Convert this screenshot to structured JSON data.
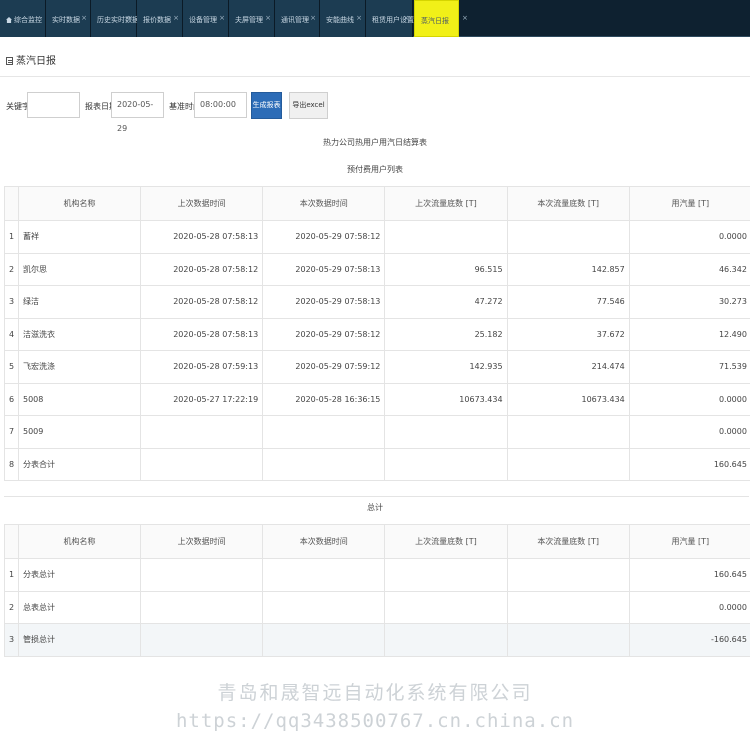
{
  "tabs": [
    {
      "label": "综合监控",
      "active": false,
      "closable": false
    },
    {
      "label": "实时数据",
      "active": false,
      "closable": true
    },
    {
      "label": "历史实时数据",
      "active": false,
      "closable": true
    },
    {
      "label": "报价数据",
      "active": false,
      "closable": true
    },
    {
      "label": "设备管理",
      "active": false,
      "closable": true
    },
    {
      "label": "夫屏管理",
      "active": false,
      "closable": true
    },
    {
      "label": "通讯管理",
      "active": false,
      "closable": true
    },
    {
      "label": "安能曲线",
      "active": false,
      "closable": true
    },
    {
      "label": "租赁用户设置",
      "active": false,
      "closable": true
    },
    {
      "label": "蒸汽日报",
      "active": true,
      "closable": true
    }
  ],
  "tab_close_glyph": "×",
  "page_title": "蒸汽日报",
  "search": {
    "keyword_label": "关键字:",
    "keyword_value": "",
    "date_label": "报表日期:",
    "date_value": "2020-05-29",
    "time_label": "基准时间:",
    "time_value": "08:00:00",
    "generate_button": "生成报表",
    "export_button": "导出excel"
  },
  "report_title": "热力公司热用户用汽日结算表",
  "section1_title": "预付费用户列表",
  "columns": [
    "机构名称",
    "上次数据时间",
    "本次数据时间",
    "上次流量底数 [T]",
    "本次流量底数 [T]",
    "用汽量 [T]"
  ],
  "rows1": [
    {
      "idx": "1",
      "name": "蓄祥",
      "last_time": "2020-05-28 07:58:13",
      "this_time": "2020-05-29 07:58:12",
      "last_base": "",
      "this_base": "",
      "usage": "0.0000"
    },
    {
      "idx": "2",
      "name": "凯尔思",
      "last_time": "2020-05-28 07:58:12",
      "this_time": "2020-05-29 07:58:13",
      "last_base": "96.515",
      "this_base": "142.857",
      "usage": "46.342"
    },
    {
      "idx": "3",
      "name": "绿洁",
      "last_time": "2020-05-28 07:58:12",
      "this_time": "2020-05-29 07:58:13",
      "last_base": "47.272",
      "this_base": "77.546",
      "usage": "30.273"
    },
    {
      "idx": "4",
      "name": "洁滋洗衣",
      "last_time": "2020-05-28 07:58:13",
      "this_time": "2020-05-29 07:58:12",
      "last_base": "25.182",
      "this_base": "37.672",
      "usage": "12.490"
    },
    {
      "idx": "5",
      "name": "飞宏洗涤",
      "last_time": "2020-05-28 07:59:13",
      "this_time": "2020-05-29 07:59:12",
      "last_base": "142.935",
      "this_base": "214.474",
      "usage": "71.539"
    },
    {
      "idx": "6",
      "name": "5008",
      "last_time": "2020-05-27 17:22:19",
      "this_time": "2020-05-28 16:36:15",
      "last_base": "10673.434",
      "this_base": "10673.434",
      "usage": "0.0000"
    },
    {
      "idx": "7",
      "name": "5009",
      "last_time": "",
      "this_time": "",
      "last_base": "",
      "this_base": "",
      "usage": "0.0000"
    },
    {
      "idx": "8",
      "name": "分表合计",
      "last_time": "",
      "this_time": "",
      "last_base": "",
      "this_base": "",
      "usage": "160.645"
    }
  ],
  "section2_title": "总计",
  "rows2": [
    {
      "idx": "1",
      "name": "分表总计",
      "last_time": "",
      "this_time": "",
      "last_base": "",
      "this_base": "",
      "usage": "160.645"
    },
    {
      "idx": "2",
      "name": "总表总计",
      "last_time": "",
      "this_time": "",
      "last_base": "",
      "this_base": "",
      "usage": "0.0000"
    },
    {
      "idx": "3",
      "name": "管损总计",
      "last_time": "",
      "this_time": "",
      "last_base": "",
      "this_base": "",
      "usage": "-160.645"
    }
  ],
  "watermark_company": "青岛和晟智远自动化系统有限公司",
  "watermark_url": "https://qq3438500767.cn.china.cn",
  "colors": {
    "tab_bg": "#1c3c52",
    "tab_active": "#f1f018",
    "primary_button": "#2c6cb7"
  }
}
